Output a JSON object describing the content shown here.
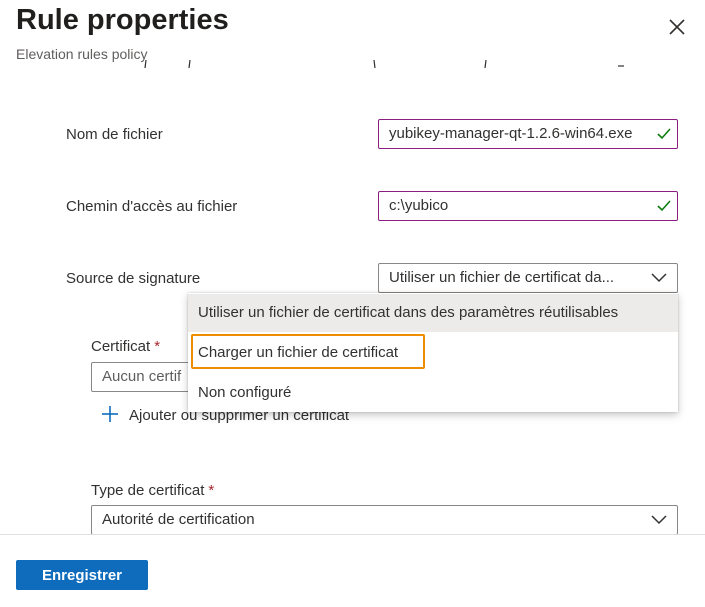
{
  "panel": {
    "title": "Rule properties",
    "subtitle": "Elevation rules policy"
  },
  "form": {
    "file_name": {
      "label": "Nom de fichier",
      "value": "yubikey-manager-qt-1.2.6-win64.exe"
    },
    "file_path": {
      "label": "Chemin d'accès au fichier",
      "value": "c:\\yubico"
    },
    "signature_source": {
      "label": "Source de signature",
      "selected": "Utiliser un fichier de certificat da..."
    },
    "certificate": {
      "label": "Certificat",
      "required_mark": "*",
      "placeholder": "Aucun certif"
    },
    "add_certificate_link": "Ajouter ou supprimer un certificat",
    "certificate_type": {
      "label": "Type de certificat",
      "required_mark": "*",
      "selected": "Autorité de certification"
    }
  },
  "dropdown": {
    "options": [
      "Utiliser un fichier de certificat dans des paramètres réutilisables",
      "Charger un fichier de certificat",
      "Non configuré"
    ],
    "highlight_color": "#f08c00"
  },
  "footer": {
    "save_label": "Enregistrer"
  },
  "colors": {
    "primary": "#0f6cbd",
    "valid_check": "#107c10",
    "active_border": "#8a1e82",
    "required": "#a4262c"
  },
  "icons": {
    "close": "close-icon",
    "check": "checkmark-icon",
    "chevron": "chevron-down-icon",
    "add": "plus-icon"
  }
}
